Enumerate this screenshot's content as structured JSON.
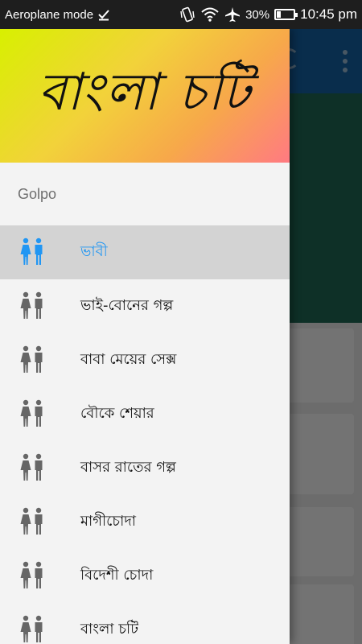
{
  "status_bar": {
    "mode_label": "Aeroplane mode",
    "battery_percent": "30%",
    "battery_level": 0.3,
    "time": "10:45 pm",
    "icons": [
      "download-done-icon",
      "vibrate-icon",
      "wifi-icon",
      "airplane-icon",
      "battery-icon"
    ]
  },
  "drawer": {
    "header_title": "বাংলা চটি",
    "header_gradient": [
      "#d8f000",
      "#f2d23a",
      "#f7a84a",
      "#ff7a82"
    ],
    "section_label": "Golpo",
    "items": [
      {
        "label": "ভাবী",
        "selected": true,
        "icon": "couple-icon"
      },
      {
        "label": "ভাই-বোনের গল্প",
        "selected": false,
        "icon": "couple-icon"
      },
      {
        "label": "বাবা মেয়ের সেক্স",
        "selected": false,
        "icon": "couple-icon"
      },
      {
        "label": "বৌকে শেয়ার",
        "selected": false,
        "icon": "couple-icon"
      },
      {
        "label": "বাসর রাতের গল্প",
        "selected": false,
        "icon": "couple-icon"
      },
      {
        "label": "মাগীচোদা",
        "selected": false,
        "icon": "couple-icon"
      },
      {
        "label": "বিদেশী চোদা",
        "selected": false,
        "icon": "couple-icon"
      },
      {
        "label": "বাংলা চটি",
        "selected": false,
        "icon": "couple-icon"
      }
    ]
  },
  "colors": {
    "accent": "#2196f3",
    "icon_gray": "#666666",
    "selected_bg": "#d3d3d3",
    "toolbar": "#1565a8"
  }
}
